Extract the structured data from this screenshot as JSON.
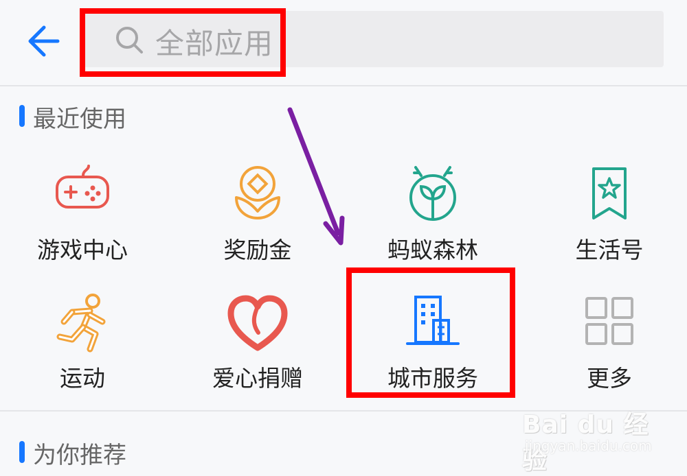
{
  "header": {
    "back_icon": "arrow-left-icon",
    "search_placeholder": "全部应用",
    "search_icon": "search-icon"
  },
  "sections": {
    "recent": {
      "title": "最近使用"
    },
    "recommend": {
      "title": "为你推荐"
    }
  },
  "apps": [
    {
      "label": "游戏中心",
      "icon": "gamepad-icon",
      "color": "#e8584f"
    },
    {
      "label": "奖励金",
      "icon": "coin-lotus-icon",
      "color": "#f2a33a"
    },
    {
      "label": "蚂蚁森林",
      "icon": "ant-sprout-icon",
      "color": "#23a58d"
    },
    {
      "label": "生活号",
      "icon": "star-bookmark-icon",
      "color": "#23a58d"
    },
    {
      "label": "运动",
      "icon": "runner-icon",
      "color": "#f2a33a"
    },
    {
      "label": "爱心捐赠",
      "icon": "heart-icon",
      "color": "#e8584f"
    },
    {
      "label": "城市服务",
      "icon": "building-icon",
      "color": "#1677ff"
    },
    {
      "label": "更多",
      "icon": "grid-more-icon",
      "color": "#b3b3b3"
    }
  ],
  "colors": {
    "accent": "#1677ff",
    "annotation_red": "#ff0000",
    "annotation_arrow": "#7a1fa2"
  },
  "watermark": {
    "brand": "Bai  du 经验",
    "url": "jingyan.baidu.com"
  }
}
